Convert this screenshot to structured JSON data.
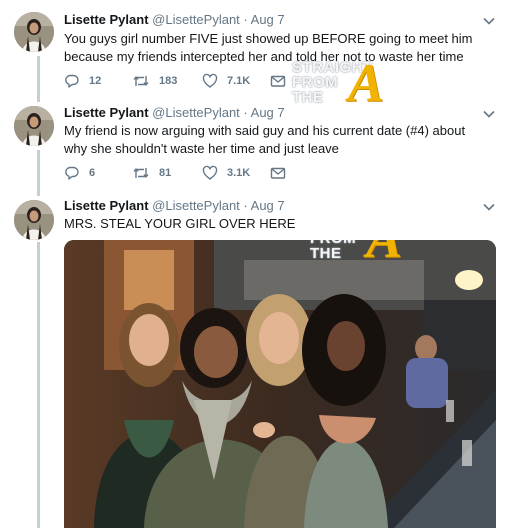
{
  "tweets": [
    {
      "name": "Lisette Pylant",
      "handle": "@LisettePylant",
      "date": "· Aug 7",
      "text": "You guys girl number FIVE just showed up BEFORE going to meet him because my friends intercepted her and told her not to waste her time",
      "replies": "12",
      "retweets": "183",
      "likes": "7.1K"
    },
    {
      "name": "Lisette Pylant",
      "handle": "@LisettePylant",
      "date": "· Aug 7",
      "text": "My friend is now arguing with said guy and his current date (#4) about why she shouldn't waste her time and just leave",
      "replies": "6",
      "retweets": "81",
      "likes": "3.1K"
    },
    {
      "name": "Lisette Pylant",
      "handle": "@LisettePylant",
      "date": "· Aug 7",
      "text": "MRS. STEAL YOUR GIRL OVER HERE"
    }
  ],
  "watermark": {
    "line1": "STRAIGHT",
    "line2": "FROM",
    "line3": "THE",
    "letter": "A"
  },
  "icons": {
    "reply": "reply-icon",
    "retweet": "retweet-icon",
    "like": "heart-icon",
    "message": "message-icon",
    "caret": "chevron-down-icon"
  },
  "colors": {
    "thread_line": "#c4cfd6",
    "muted_text": "#657786",
    "watermark_accent": "#f2b300"
  }
}
